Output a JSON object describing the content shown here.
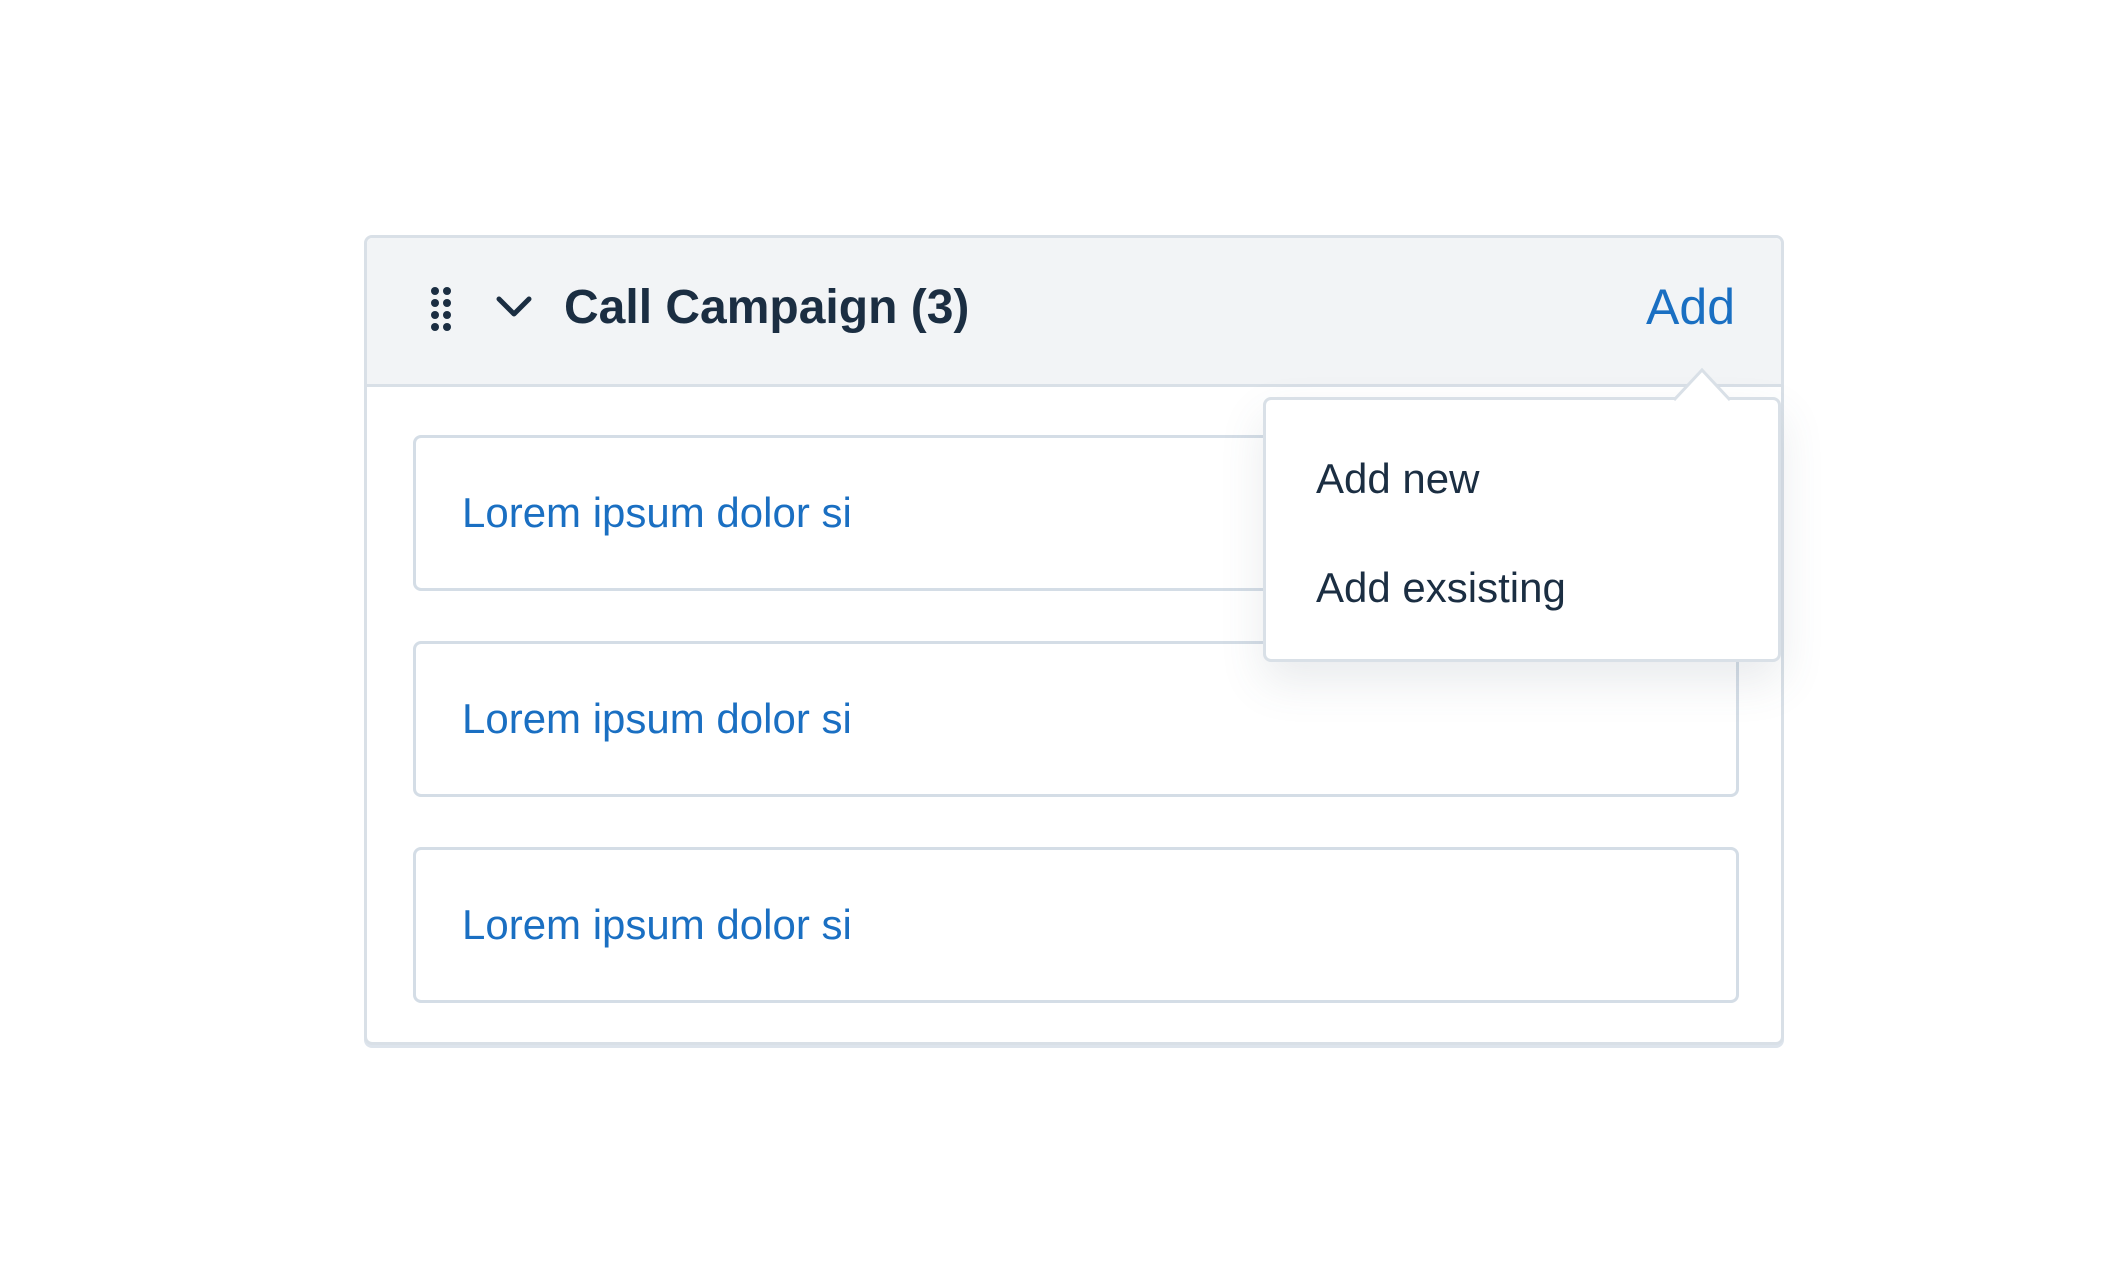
{
  "panel": {
    "title": "Call Campaign (3)",
    "add_label": "Add",
    "drag_icon": "drag-handle-icon",
    "collapse_icon": "chevron-down-icon"
  },
  "items": [
    {
      "label": "Lorem ipsum dolor si"
    },
    {
      "label": "Lorem ipsum dolor si"
    },
    {
      "label": "Lorem ipsum dolor si"
    }
  ],
  "add_menu": {
    "options": [
      {
        "label": "Add new"
      },
      {
        "label": "Add exsisting"
      }
    ]
  },
  "colors": {
    "link": "#1a6fc2",
    "text": "#1b2e42",
    "header_bg": "#f2f4f6",
    "border": "#d9e0e7"
  }
}
